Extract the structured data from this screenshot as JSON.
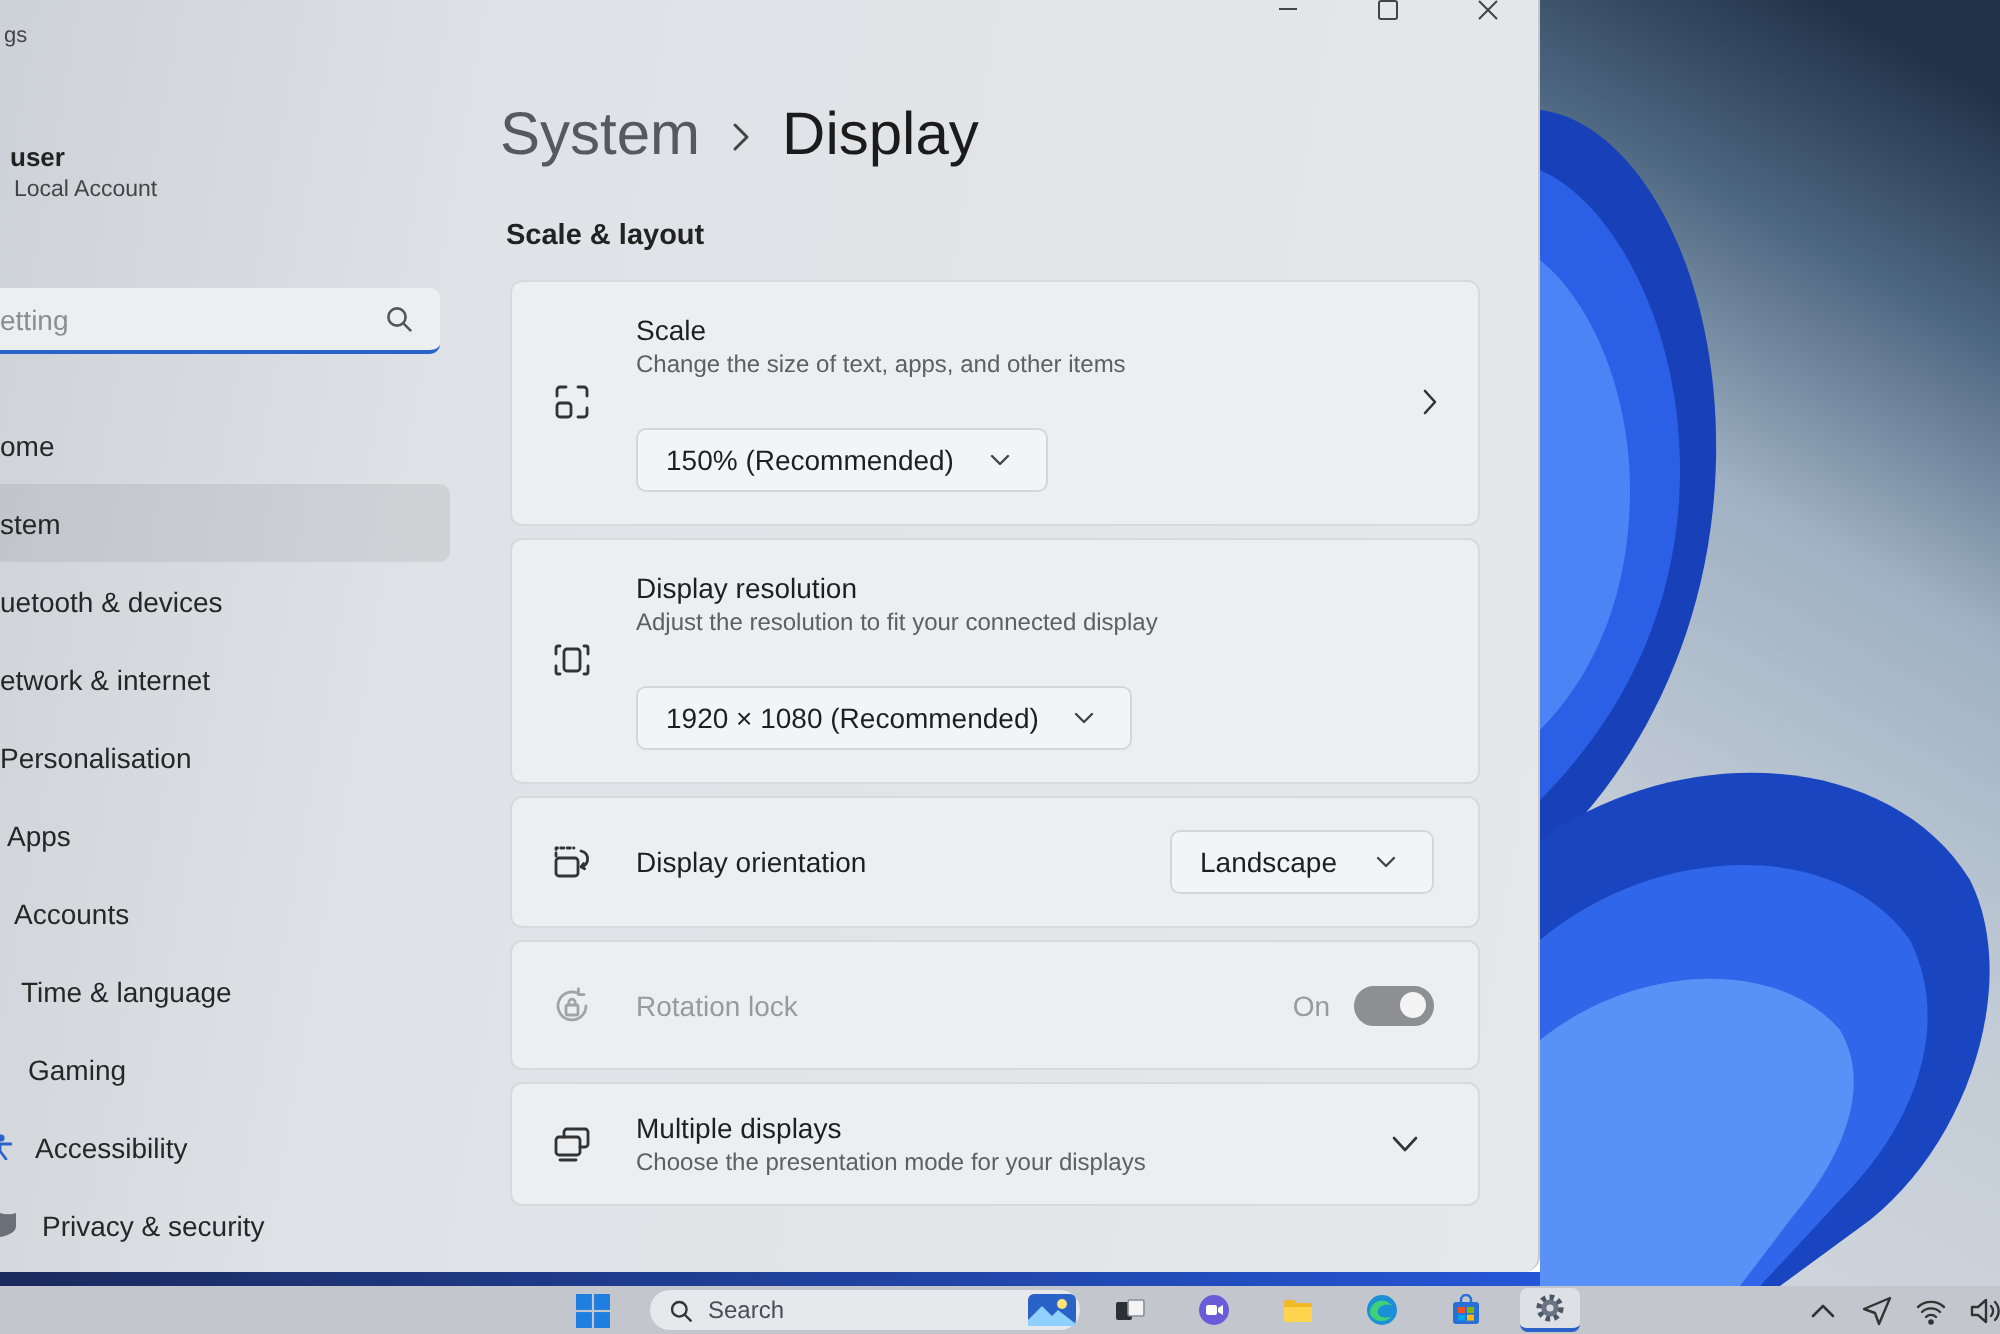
{
  "window": {
    "title": "gs"
  },
  "account": {
    "name": "user",
    "type": "Local Account"
  },
  "search": {
    "placeholder": "etting"
  },
  "nav": [
    {
      "label": "ome",
      "selected": false
    },
    {
      "label": "stem",
      "selected": true
    },
    {
      "label": "uetooth & devices",
      "selected": false
    },
    {
      "label": "etwork & internet",
      "selected": false
    },
    {
      "label": "Personalisation",
      "selected": false
    },
    {
      "label": "Apps",
      "selected": false
    },
    {
      "label": "Accounts",
      "selected": false
    },
    {
      "label": "Time & language",
      "selected": false
    },
    {
      "label": "Gaming",
      "selected": false
    },
    {
      "label": "Accessibility",
      "selected": false
    },
    {
      "label": "Privacy & security",
      "selected": false
    }
  ],
  "breadcrumb": {
    "parent": "System",
    "current": "Display"
  },
  "section": {
    "title": "Scale & layout"
  },
  "settings": [
    {
      "kind": "stacked",
      "title": "Scale",
      "description": "Change the size of text, apps, and other items",
      "value": "150% (Recommended)",
      "navigable": true,
      "disabled": false
    },
    {
      "kind": "stacked",
      "title": "Display resolution",
      "description": "Adjust the resolution to fit your connected display",
      "value": "1920 × 1080 (Recommended)",
      "navigable": false,
      "disabled": false
    },
    {
      "kind": "inline",
      "title": "Display orientation",
      "value": "Landscape",
      "disabled": false
    },
    {
      "kind": "toggle",
      "title": "Rotation lock",
      "state_label": "On",
      "on": true,
      "disabled": true
    },
    {
      "kind": "expander",
      "title": "Multiple displays",
      "description": "Choose the presentation mode for your displays",
      "expanded": false,
      "disabled": false
    }
  ],
  "taskbar": {
    "search": {
      "placeholder": "Search"
    },
    "apps": [
      {
        "selected": false
      },
      {
        "selected": false
      },
      {
        "selected": false
      },
      {
        "selected": false
      },
      {
        "selected": false
      },
      {
        "selected": true
      }
    ]
  }
}
